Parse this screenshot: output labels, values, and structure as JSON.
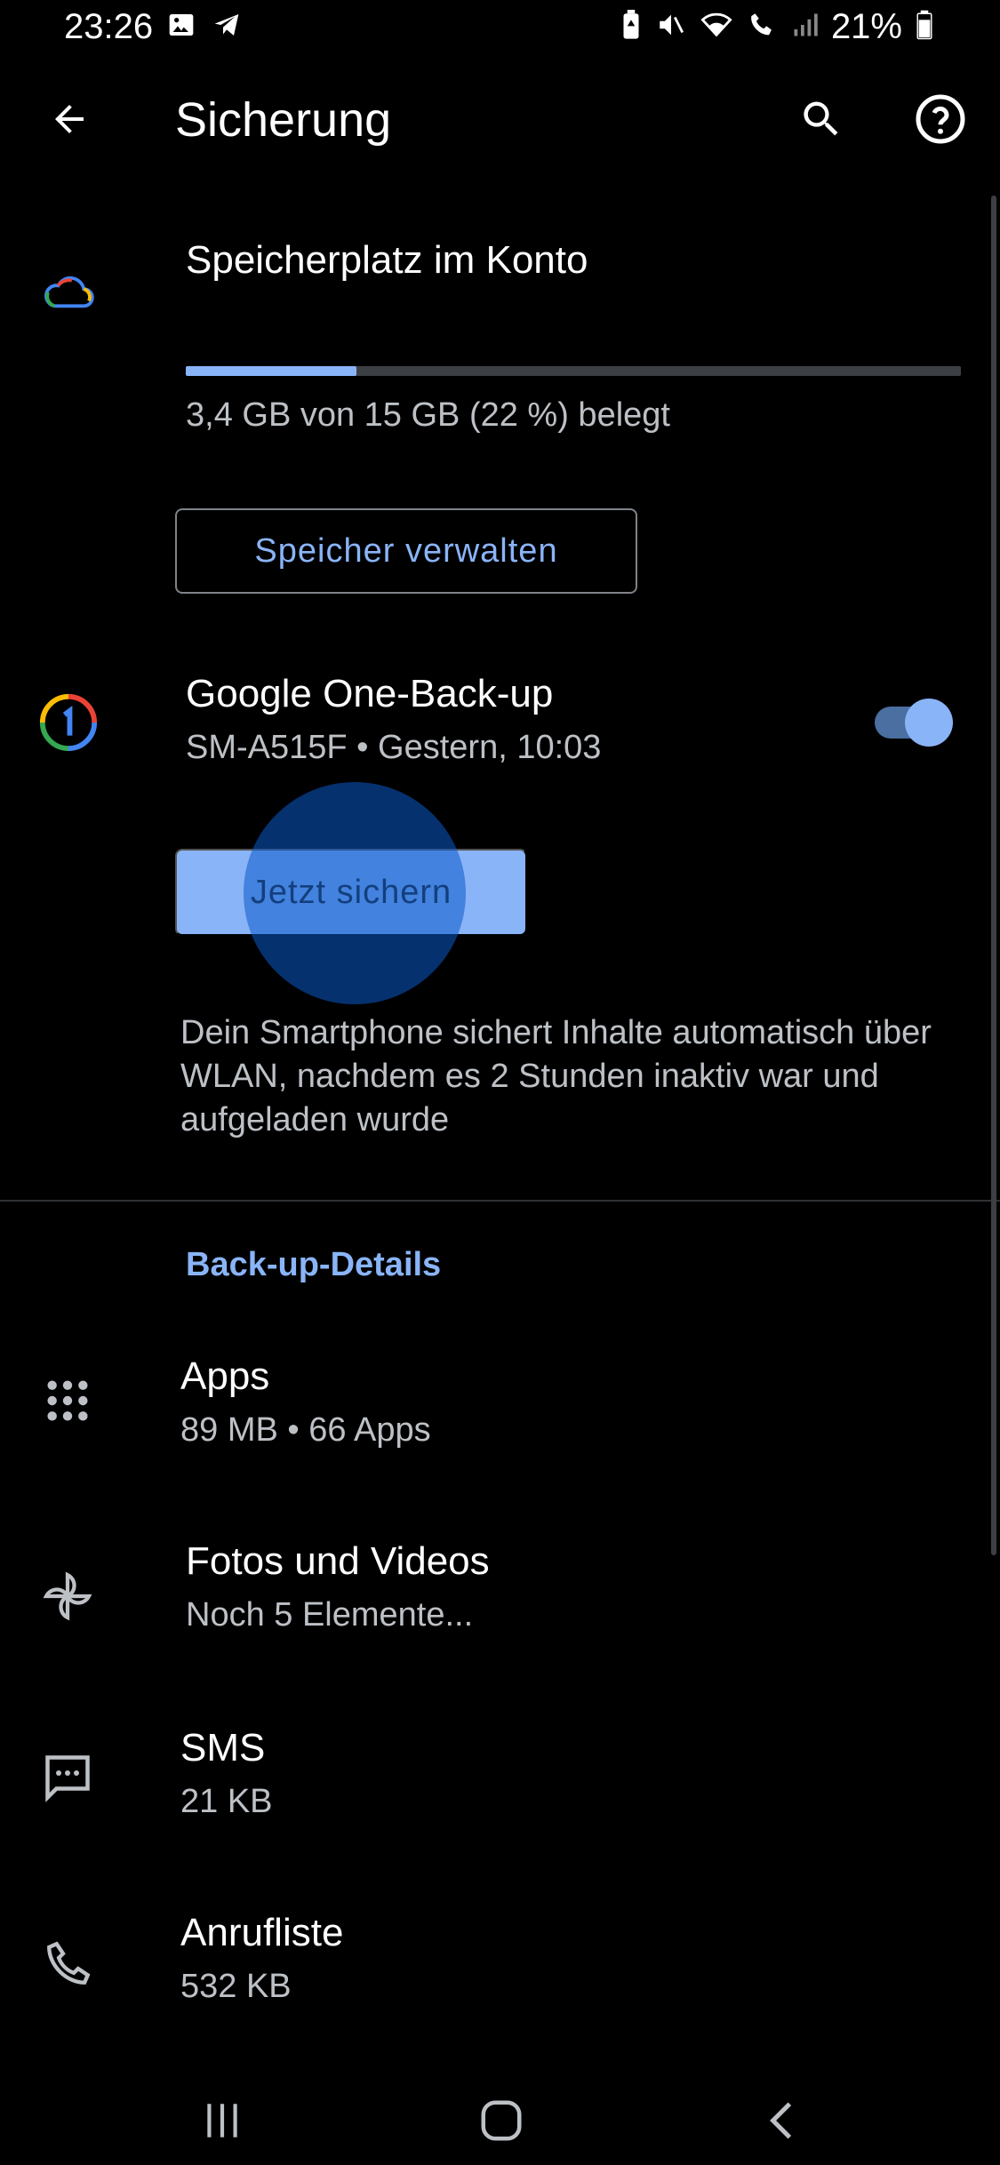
{
  "status_bar": {
    "time": "23:26",
    "battery_percent": "21%",
    "left_icons": [
      "gallery-icon",
      "telegram-icon"
    ],
    "right_icons": [
      "battery-saver-icon",
      "mute-icon",
      "wifi-icon",
      "wifi-call-icon",
      "signal-icon",
      "battery-icon"
    ]
  },
  "app_bar": {
    "title": "Sicherung",
    "back_icon": "arrow-back-icon",
    "search_icon": "search-icon",
    "help_icon": "help-icon"
  },
  "storage": {
    "title": "Speicherplatz im Konto",
    "usage_text": "3,4 GB von 15 GB (22 %) belegt",
    "used_fraction": 0.22,
    "manage_button": "Speicher verwalten"
  },
  "backup": {
    "title": "Google One-Back-up",
    "subtitle": "SM-A515F • Gestern, 10:03",
    "enabled": true,
    "backup_now_button": "Jetzt sichern",
    "info_text": "Dein Smartphone sichert Inhalte automatisch über WLAN, nachdem es 2 Stunden inaktiv war und aufgeladen wurde"
  },
  "details": {
    "header": "Back-up-Details",
    "items": [
      {
        "title": "Apps",
        "subtitle": "89 MB • 66 Apps",
        "icon": "apps-grid-icon"
      },
      {
        "title": "Fotos und Videos",
        "subtitle": "Noch 5 Elemente...",
        "icon": "pinwheel-icon"
      },
      {
        "title": "SMS",
        "subtitle": "21 KB",
        "icon": "message-icon"
      },
      {
        "title": "Anrufliste",
        "subtitle": "532 KB",
        "icon": "phone-icon"
      }
    ]
  },
  "colors": {
    "accent": "#8ab4f8",
    "background": "#000000",
    "secondary_text": "#bdc1c6"
  }
}
